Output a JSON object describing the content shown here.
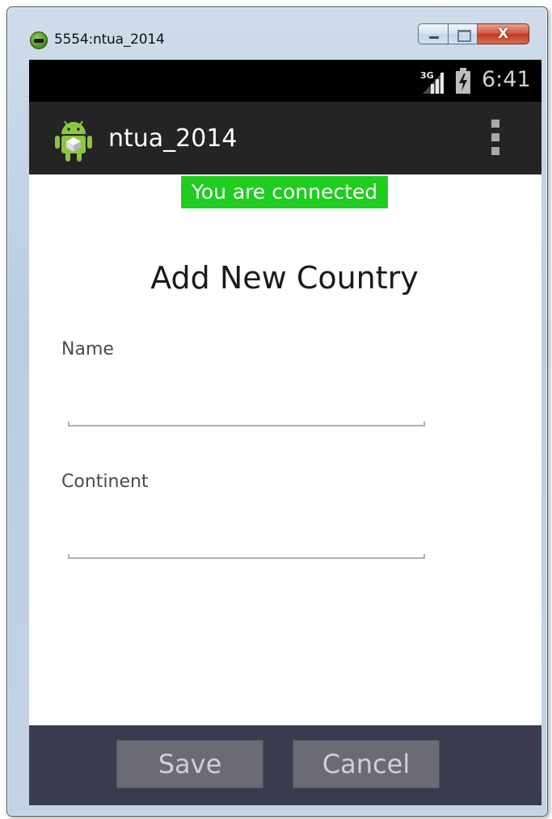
{
  "window": {
    "title": "5554:ntua_2014",
    "close_glyph": "X"
  },
  "status_bar": {
    "network": "3G",
    "time": "6:41"
  },
  "action_bar": {
    "title": "ntua_2014"
  },
  "connection": {
    "message": "You are connected",
    "color": "#1fcd1f"
  },
  "form": {
    "heading": "Add New Country",
    "fields": [
      {
        "label": "Name",
        "value": ""
      },
      {
        "label": "Continent",
        "value": ""
      }
    ]
  },
  "buttons": {
    "save": "Save",
    "cancel": "Cancel"
  },
  "colors": {
    "status_bar": "#000000",
    "action_bar": "#242424",
    "bottom_bar": "#3a3b4e",
    "button": "#6b6b76"
  },
  "icons": [
    "emulator-app-icon",
    "minimize-icon",
    "maximize-icon",
    "close-icon",
    "signal-3g-icon",
    "battery-charging-icon",
    "android-logo-icon",
    "overflow-menu-icon"
  ]
}
